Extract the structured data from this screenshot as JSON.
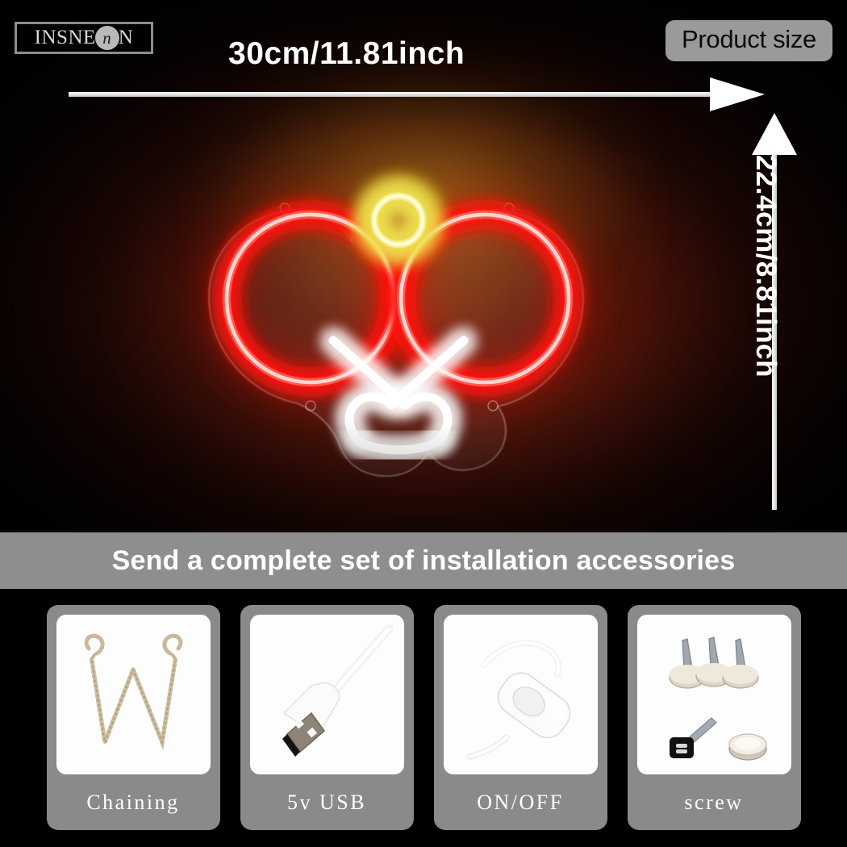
{
  "brand": {
    "logo_prefix": "INSNE",
    "logo_mark": "n",
    "logo_suffix": "N"
  },
  "header": {
    "size_badge": "Product size"
  },
  "dimensions": {
    "width_label": "30cm/11.81inch",
    "height_label": "22.4cm/8.81inch"
  },
  "product": {
    "type": "neon-sign",
    "subject": "ping-pong-paddles",
    "colors": {
      "paddle_neon": "#ff2020",
      "paddle_core": "#ffd8d8",
      "ball_neon": "#ece04a",
      "ball_core": "#fffbd0",
      "handle_neon": "#ffffff",
      "backing": "rgba(255,255,255,0.16)",
      "glow_ambient": "#962812"
    }
  },
  "banner": {
    "text": "Send a complete set of installation accessories",
    "bg": "#8e8e8e"
  },
  "accessories": {
    "card_bg": "#8a8a8a",
    "items": [
      {
        "label": "Chaining",
        "icon": "hanging-chain-icon"
      },
      {
        "label": "5v USB",
        "icon": "usb-cable-icon"
      },
      {
        "label": "ON/OFF",
        "icon": "inline-switch-icon"
      },
      {
        "label": "screw",
        "icon": "screws-icon"
      }
    ]
  }
}
